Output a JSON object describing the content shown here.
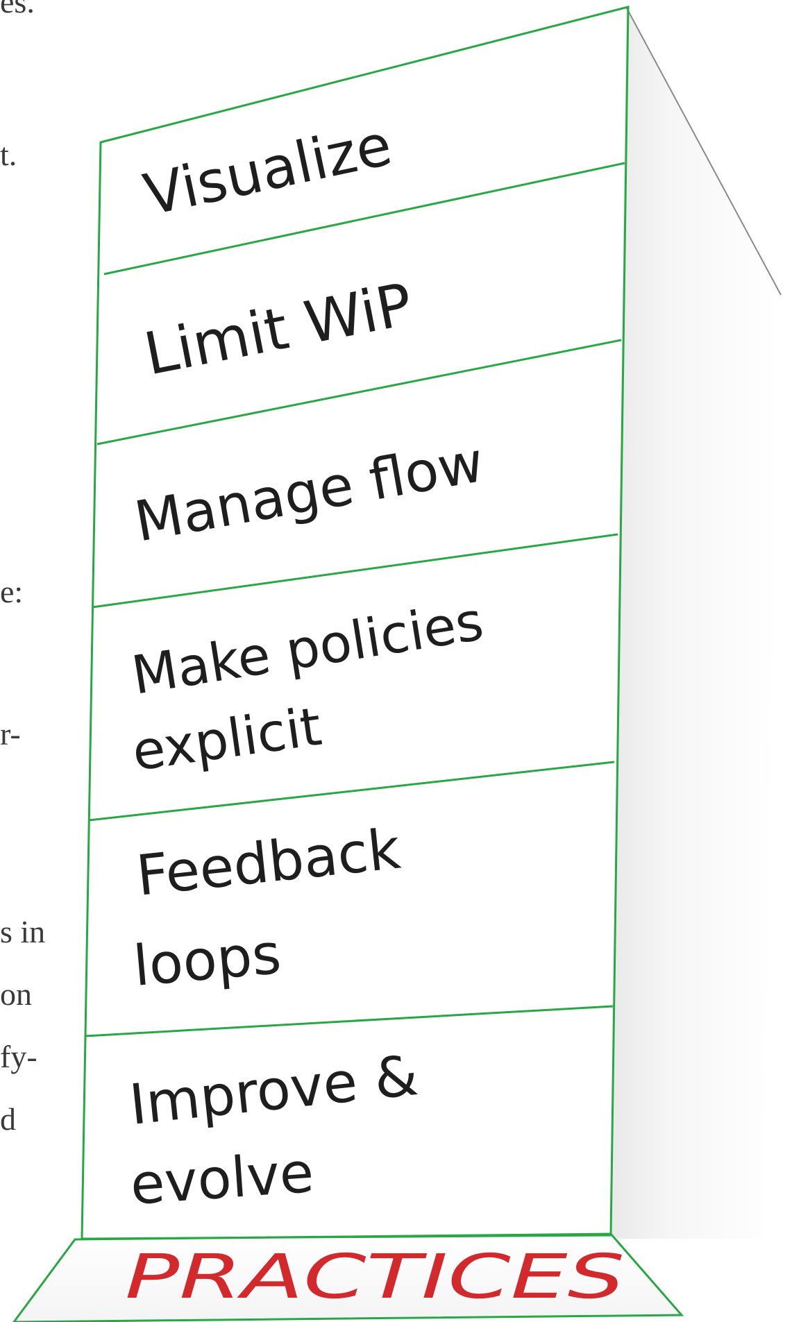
{
  "page_text_fragments": [
    "es.",
    "t.",
    "e:",
    "r-",
    "s in",
    "on",
    "fy-",
    "d"
  ],
  "tower": {
    "blocks": [
      {
        "lines": [
          "Visualize"
        ]
      },
      {
        "lines": [
          "Limit WiP"
        ]
      },
      {
        "lines": [
          "Manage flow"
        ]
      },
      {
        "lines": [
          "Make policies",
          "explicit"
        ]
      },
      {
        "lines": [
          "Feedback",
          "loops"
        ]
      },
      {
        "lines": [
          "Improve &",
          "evolve"
        ]
      }
    ],
    "base_label": "PRACTICES"
  },
  "colors": {
    "outline": "#27a844",
    "handwriting": "#1e1e1e",
    "base_label": "#d2292d",
    "side_shade": "#eeeeee",
    "body_text": "#3a3a3a"
  }
}
